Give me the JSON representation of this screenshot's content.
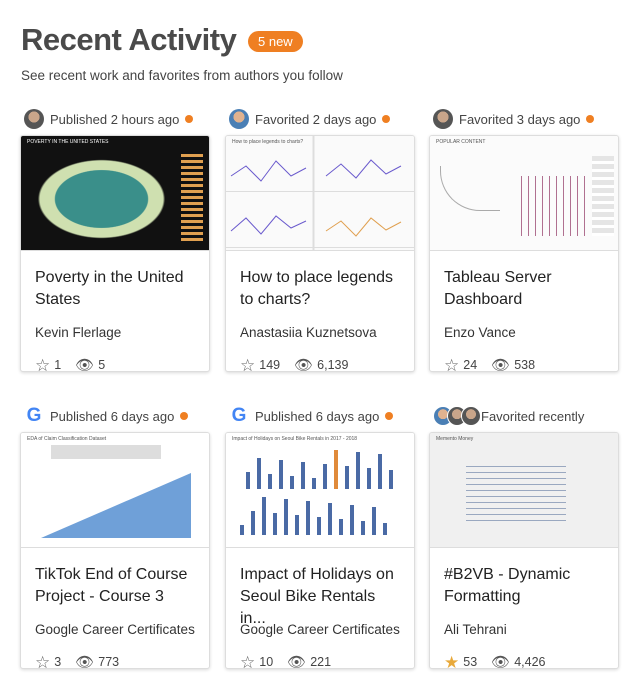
{
  "header": {
    "title": "Recent Activity",
    "badge": "5 new",
    "subtitle": "See recent work and favorites from authors you follow"
  },
  "accent": "#ef7f22",
  "cards": [
    {
      "activity": "Published 2 hours ago",
      "title": "Poverty in the United States",
      "author": "Kevin Flerlage",
      "favorites": "1",
      "views": "5",
      "favorited": false,
      "thumb_title": "POVERTY IN THE UNITED STATES"
    },
    {
      "activity": "Favorited 2 days ago",
      "title": "How to place legends to charts?",
      "author": "Anastasiia Kuznetsova",
      "favorites": "149",
      "views": "6,139",
      "favorited": false,
      "thumb_title": "How to place legends to charts?"
    },
    {
      "activity": "Favorited 3 days ago",
      "title": "Tableau Server Dashboard",
      "author": "Enzo Vance",
      "favorites": "24",
      "views": "538",
      "favorited": false,
      "thumb_title": "POPULAR CONTENT"
    },
    {
      "activity": "Published 6 days ago",
      "title": "TikTok End of Course Project - Course 3",
      "author": "Google Career Certificates",
      "favorites": "3",
      "views": "773",
      "favorited": false,
      "thumb_title": "EDA of Claim Classification Dataset"
    },
    {
      "activity": "Published 6 days ago",
      "title": "Impact of Holidays on Seoul Bike Rentals in...",
      "author": "Google Career Certificates",
      "favorites": "10",
      "views": "221",
      "favorited": false,
      "thumb_title": "Impact of Holidays on Seoul Bike Rentals in 2017 - 2018"
    },
    {
      "activity": "Favorited recently",
      "title": "#B2VB - Dynamic Formatting",
      "author": "Ali Tehrani",
      "favorites": "53",
      "views": "4,426",
      "favorited": true,
      "thumb_title": "Memento Money"
    }
  ]
}
